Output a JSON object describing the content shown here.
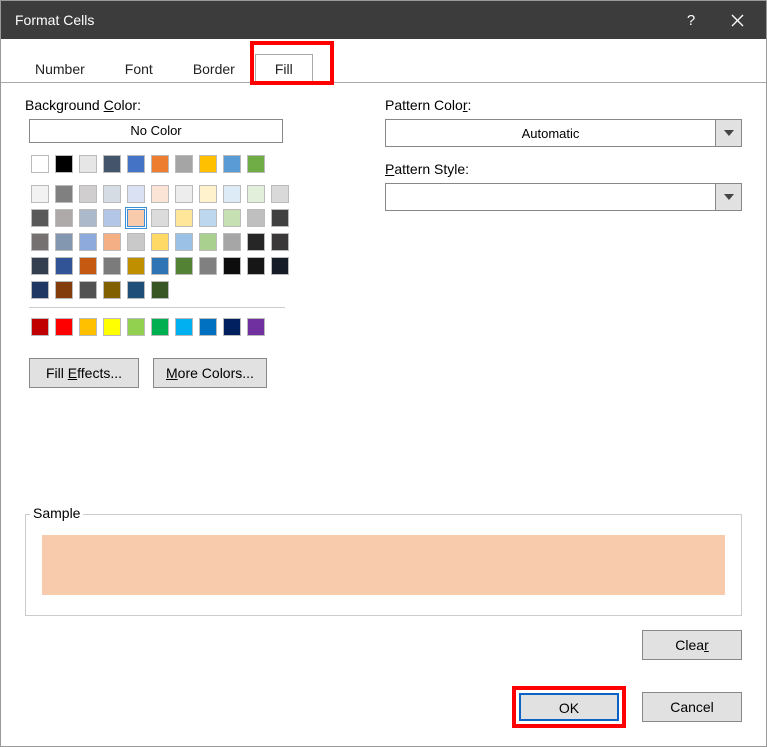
{
  "title": "Format Cells",
  "tabs": [
    {
      "label": "Number"
    },
    {
      "label": "Font"
    },
    {
      "label": "Border"
    },
    {
      "label": "Fill",
      "active": true
    }
  ],
  "labels": {
    "background_color": "Background Color:",
    "no_color": "No Color",
    "pattern_color": "Pattern Color:",
    "pattern_style": "Pattern Style:",
    "pattern_color_value": "Automatic",
    "pattern_style_value": "",
    "fill_effects": "Fill Effects...",
    "more_colors": "More Colors...",
    "sample": "Sample",
    "clear": "Clear",
    "ok": "OK",
    "cancel": "Cancel"
  },
  "selected_color": "#f8cbad",
  "theme_row": [
    "#ffffff",
    "#000000",
    "#e7e6e6",
    "#44546a",
    "#4472c4",
    "#ed7d31",
    "#a5a5a5",
    "#ffc000",
    "#5b9bd5",
    "#70ad47"
  ],
  "theme_grid": [
    [
      "#f2f2f2",
      "#808080",
      "#d0cece",
      "#d6dce4",
      "#d9e1f2",
      "#fbe4d5",
      "#ededed",
      "#fff2cc",
      "#ddebf7",
      "#e2efda"
    ],
    [
      "#d9d9d9",
      "#595959",
      "#aeaaaa",
      "#acb9ca",
      "#b4c6e7",
      "#f8cbad",
      "#dbdbdb",
      "#ffe699",
      "#bdd7ee",
      "#c6e0b4"
    ],
    [
      "#bfbfbf",
      "#404040",
      "#757171",
      "#8497b0",
      "#8ea9db",
      "#f4b084",
      "#c9c9c9",
      "#ffd966",
      "#9bc2e6",
      "#a9d08e"
    ],
    [
      "#a6a6a6",
      "#262626",
      "#3a3838",
      "#333f4f",
      "#305496",
      "#c65911",
      "#7b7b7b",
      "#bf8f00",
      "#2f75b5",
      "#548235"
    ],
    [
      "#808080",
      "#0d0d0d",
      "#161616",
      "#161c27",
      "#203764",
      "#833c0c",
      "#525252",
      "#806000",
      "#1f4e78",
      "#375623"
    ]
  ],
  "standard_row": [
    "#c00000",
    "#ff0000",
    "#ffc000",
    "#ffff00",
    "#92d050",
    "#00b050",
    "#00b0f0",
    "#0070c0",
    "#002060",
    "#7030a0"
  ]
}
